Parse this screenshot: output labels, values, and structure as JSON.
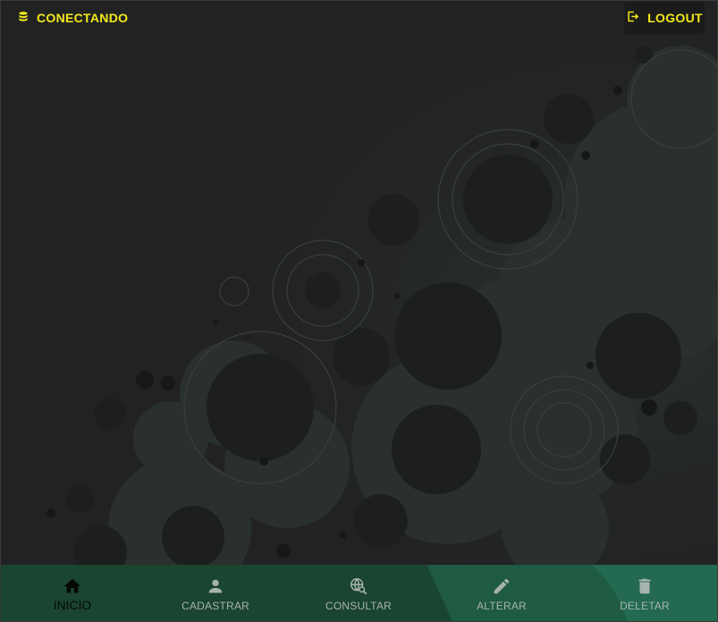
{
  "header": {
    "status_label": "CONECTANDO",
    "status_icon": "database-icon",
    "logout_label": "LOGOUT",
    "logout_icon": "logout-icon"
  },
  "bottom_nav": {
    "items": [
      {
        "label": "INICIO",
        "icon": "home-icon",
        "active": true
      },
      {
        "label": "CADASTRAR",
        "icon": "person-icon",
        "active": false
      },
      {
        "label": "CONSULTAR",
        "icon": "globe-search-icon",
        "active": false
      },
      {
        "label": "ALTERAR",
        "icon": "pencil-icon",
        "active": false
      },
      {
        "label": "DELETAR",
        "icon": "trash-icon",
        "active": false
      }
    ]
  },
  "colors": {
    "accent_yellow": "#f2ea18",
    "background": "#222223",
    "nav_green": "#1a4530",
    "nav_green_light": "#24705a"
  }
}
